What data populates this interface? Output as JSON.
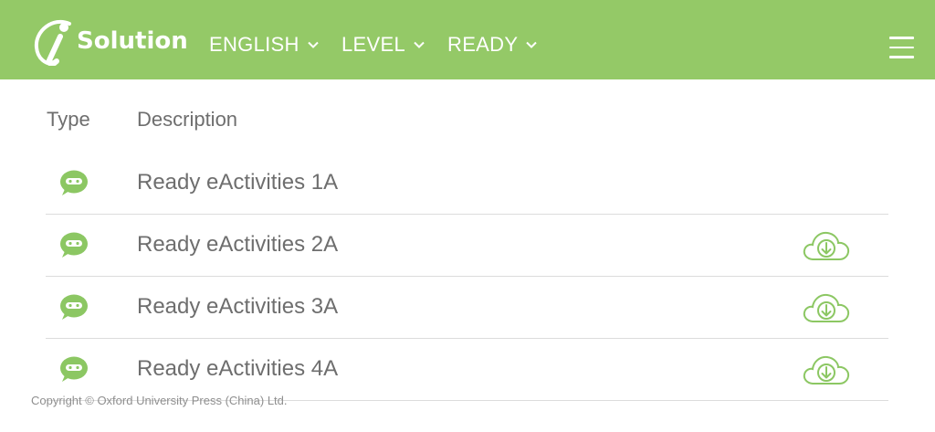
{
  "header": {
    "logo_text": "Solution",
    "logo_letter": "i",
    "nav": [
      {
        "label": "ENGLISH"
      },
      {
        "label": "LEVEL"
      },
      {
        "label": "READY"
      }
    ],
    "menu_icon": "hamburger-icon",
    "background_color": "#94c967"
  },
  "table": {
    "columns": {
      "type": "Type",
      "description": "Description"
    },
    "rows": [
      {
        "type_icon": "chat-bot-icon",
        "description": "Ready eActivities 1A",
        "download": false
      },
      {
        "type_icon": "chat-bot-icon",
        "description": "Ready eActivities 2A",
        "download": true
      },
      {
        "type_icon": "chat-bot-icon",
        "description": "Ready eActivities 3A",
        "download": true
      },
      {
        "type_icon": "chat-bot-icon",
        "description": "Ready eActivities 4A",
        "download": true
      }
    ],
    "accent_color": "#8cc763"
  },
  "footer": {
    "copyright": "Copyright © Oxford University Press (China) Ltd."
  }
}
